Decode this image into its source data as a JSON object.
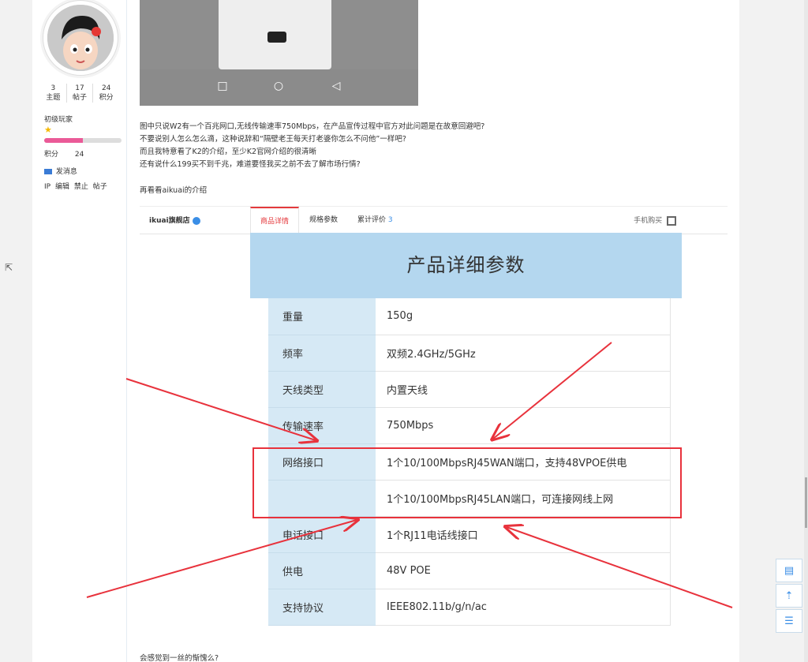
{
  "user": {
    "stats": [
      {
        "value": "3",
        "label": "主题"
      },
      {
        "value": "17",
        "label": "帖子"
      },
      {
        "value": "24",
        "label": "积分"
      }
    ],
    "level": "初级玩家",
    "level_progress": 0.5,
    "points_label": "积分",
    "points_value": "24",
    "send_message": "发消息",
    "admin_links": [
      "IP",
      "编辑",
      "禁止",
      "帖子"
    ]
  },
  "post": {
    "lines": [
      "图中只说W2有一个百兆网口,无线传输速率750Mbps，在产品宣传过程中官方对此问题是在故意回避吧?",
      "不要说别人怎么怎么滴，这种说辞和“隔壁老王每天打老婆你怎么不问他”一样吧?",
      "而且我特意看了K2的介绍，至少K2官网介绍的很清晰",
      "还有说什么199买不到千兆，难道要怪我买之前不去了解市场行情?"
    ],
    "sub_title": "再看看aikuai的介绍",
    "footer": "会感觉到一丝的惭愧么?"
  },
  "shop": {
    "name": "ikuai旗舰店",
    "tabs": [
      {
        "label": "商品详情",
        "active": true
      },
      {
        "label": "规格参数",
        "active": false
      },
      {
        "label": "累计评价",
        "count": "3",
        "active": false
      }
    ],
    "buy_phone": "手机购买"
  },
  "detail": {
    "title": "产品详细参数",
    "specs": [
      {
        "key": "重量",
        "value": "150g"
      },
      {
        "key": "频率",
        "value": "双频2.4GHz/5GHz"
      },
      {
        "key": "天线类型",
        "value": "内置天线"
      },
      {
        "key": "传输速率",
        "value": "750Mbps"
      },
      {
        "key": "网络接口",
        "value": "1个10/100MbpsRJ45WAN端口，支持48VPOE供电"
      },
      {
        "key": "",
        "value": "1个10/100MbpsRJ45LAN端口，可连接网线上网"
      },
      {
        "key": "电话接口",
        "value": "1个RJ11电话线接口"
      },
      {
        "key": "供电",
        "value": "48V POE"
      },
      {
        "key": "支持协议",
        "value": "IEEE802.11b/g/n/ac"
      }
    ]
  },
  "colors": {
    "accent_red": "#e8323c",
    "header_blue": "#b4d7ef",
    "key_blue": "#d6e9f5",
    "level_bar": "#ea5a97"
  },
  "icons": [
    "star-icon",
    "envelope-icon",
    "reply-icon",
    "back-to-top-icon",
    "list-icon",
    "qr-code-icon"
  ]
}
